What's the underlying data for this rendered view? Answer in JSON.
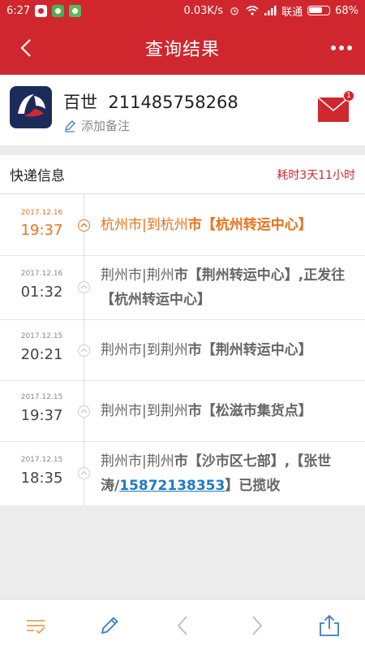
{
  "status_bar": {
    "time": "6:27",
    "net_speed": "0.03K/s",
    "carrier": "联通",
    "battery": "68%"
  },
  "app_bar": {
    "title": "查询结果",
    "back_icon": "chevron-left-icon",
    "more_icon": "more-dots-icon"
  },
  "carrier_info": {
    "name": "百世",
    "tracking_number": "211485758268",
    "add_note_label": "添加备注",
    "mail_badge_count": "1"
  },
  "section": {
    "label": "快递信息",
    "duration": "耗时3天11小时"
  },
  "events": [
    {
      "date": "2017.12.16",
      "time": "19:37",
      "city_prefix": "杭州市|到杭州",
      "city_suffix": "市",
      "text": "【杭州转运中心】",
      "active": true
    },
    {
      "date": "2017.12.16",
      "time": "01:32",
      "city_prefix": "荆州市|荆州",
      "city_suffix": "市",
      "text": "【荆州转运中心】,正发往【杭州转运中心】",
      "active": false
    },
    {
      "date": "2017.12.15",
      "time": "20:21",
      "city_prefix": "荆州市|到荆州",
      "city_suffix": "市",
      "text": "【荆州转运中心】",
      "active": false
    },
    {
      "date": "2017.12.15",
      "time": "19:37",
      "city_prefix": "荆州市|到荆州",
      "city_suffix": "市",
      "text": "【松滋市集货点】",
      "active": false
    },
    {
      "date": "2017.12.15",
      "time": "18:35",
      "city_prefix": "荆州市|荆州",
      "city_suffix": "市",
      "text_pre": "【沙市区七部】,【张世涛/",
      "phone": "15872138353",
      "text_post": "】已揽收",
      "active": false
    }
  ],
  "colors": {
    "brand_red": "#d0272f",
    "active_orange": "#e8731d",
    "link_blue": "#1e7ac8"
  },
  "bottom_bar": {
    "icons": [
      "checklist-icon",
      "edit-pen-icon",
      "prev-icon",
      "next-icon",
      "share-icon"
    ]
  }
}
